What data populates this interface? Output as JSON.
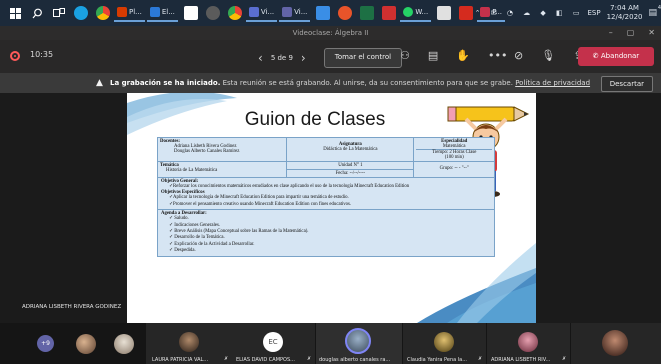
{
  "taskbar": {
    "apps": [
      {
        "label": "Pl...",
        "color": "#d83b01"
      },
      {
        "label": "El...",
        "color": "#2b79d8"
      },
      {
        "label": "Vi...",
        "color": "#5a6ed0"
      },
      {
        "label": "Vi...",
        "color": "#6264a7"
      },
      {
        "label": "W...",
        "color": "#25d366"
      },
      {
        "label": "P...",
        "color": "#c4314b"
      }
    ],
    "language": "ESP",
    "time": "7:04 AM",
    "date": "12/4/2020",
    "notification_count": "4"
  },
  "window": {
    "title": "Videoclase: Álgebra II"
  },
  "controls": {
    "elapsed_time": "10:35",
    "slide_counter": "5 de 9",
    "take_control_label": "Tomar el control",
    "hang_up_label": "Abandonar"
  },
  "banner": {
    "bold_text": "La grabación se ha iniciado.",
    "text": " Esta reunión se está grabando. Al unirse, da su consentimiento para que se grabe. ",
    "link": "Política de privacidad",
    "dismiss_label": "Descartar"
  },
  "slide": {
    "title": "Guion de Clases",
    "docentes_label": "Docentes:",
    "docente_1": "Adriana Lisbeth Rivera Godinez",
    "docente_2": "Douglas Alberto Canales Ramirez",
    "asignatura_label": "Asignatura",
    "asignatura": "Didáctica de La Matemática",
    "especialidad_label": "Especialidad",
    "especialidad": "Matemática",
    "tiempo": "Tiempo: 2 Horas Clase",
    "minutos": "(100 min)",
    "tematica_label": "Temática",
    "tematica": "Historia de La Matemática",
    "unidad": "Unidad N° 1",
    "fecha": "Fecha: --/--/----",
    "grupo": "Grupo: -- - \"--\"",
    "obj_general_label": "Objetivo General:",
    "obj_general": "✓Reforzar los conocimientos matemáticos estudiados en clase aplicando el uso de la tecnología Minecraft Education Edition",
    "obj_especificos_label": "Objetivos Específicos",
    "obj_esp_1": "✓Aplicar la tecnología de Minecraft Education Edition para impartir una temática de estudio.",
    "obj_esp_2": "✓Promover el pensamiento creativo usando Minecraft Education Edition con fines educativos.",
    "agenda_label": "Agenda a Desarrollar:",
    "agenda": [
      "✓ Saludo.",
      "✓ Indicaciones Generales.",
      "✓ Breve Análisis (Mapa Conceptual sobre las Ramas de la Matemática).",
      "✓ Desarrollo de la Temática.",
      "✓ Explicación de la Actividad a Desarrollar.",
      "✓ Despedida."
    ]
  },
  "presenter_name": "ADRIANA LISBETH RIVERA GODINEZ",
  "gallery": {
    "more_count": "+9",
    "ec_initials": "EC",
    "participants": [
      "LAURA PATRICIA VAL...",
      "ELIAS DAVID CAMPOS...",
      "douglas alberto canales ra...",
      "Claudia Yanira Pena la...",
      "ADRIANA LISBETH RIV..."
    ]
  }
}
